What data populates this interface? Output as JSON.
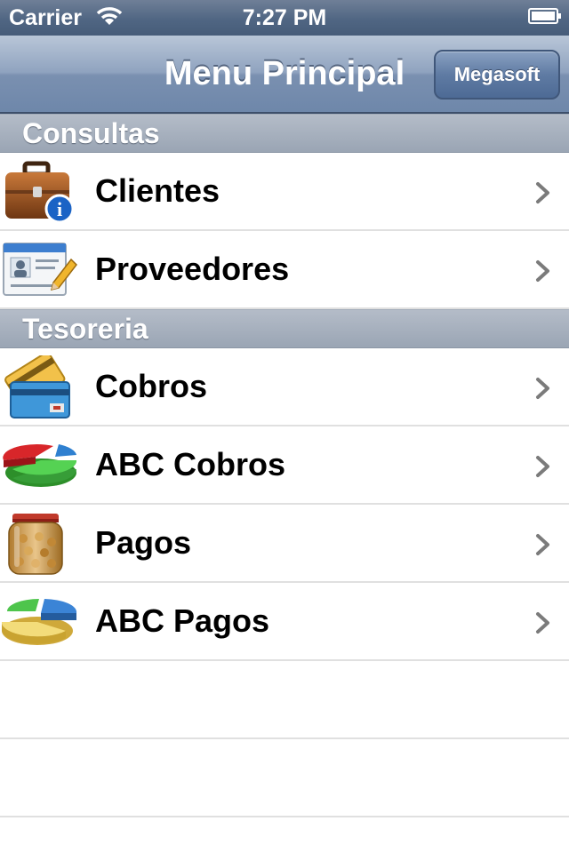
{
  "status_bar": {
    "carrier": "Carrier",
    "time": "7:27 PM"
  },
  "nav": {
    "title": "Menu Principal",
    "button_label": "Megasoft"
  },
  "sections": [
    {
      "header": "Consultas",
      "items": [
        {
          "label": "Clientes",
          "icon": "briefcase-info-icon"
        },
        {
          "label": "Proveedores",
          "icon": "contact-card-pencil-icon"
        }
      ]
    },
    {
      "header": "Tesoreria",
      "items": [
        {
          "label": "Cobros",
          "icon": "credit-cards-icon"
        },
        {
          "label": "ABC Cobros",
          "icon": "pie-chart-red-icon"
        },
        {
          "label": "Pagos",
          "icon": "coin-jar-icon"
        },
        {
          "label": "ABC Pagos",
          "icon": "pie-chart-yellow-icon"
        }
      ]
    }
  ],
  "colors": {
    "nav_bar": "#7a90b0",
    "section_header": "#9aa5b4",
    "separator": "#e0e0e0"
  }
}
